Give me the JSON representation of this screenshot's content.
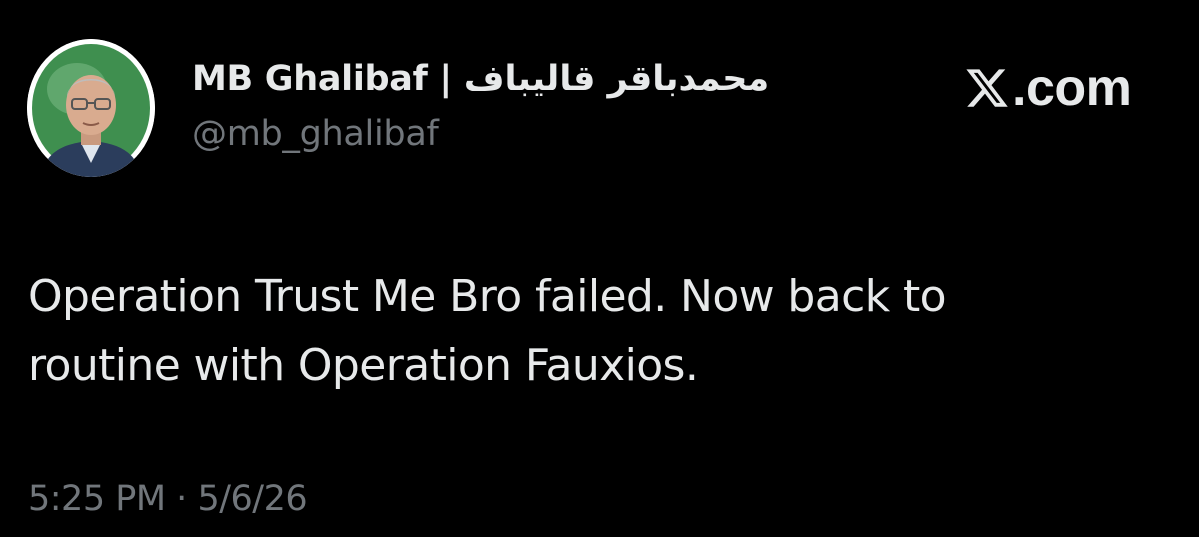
{
  "tweet": {
    "display_name": "MB Ghalibaf | محمدباقر قالیباف",
    "handle": "@mb_ghalibaf",
    "text": "Operation Trust Me Bro failed. Now back to\nroutine with Operation Fauxios.",
    "time": "5:25 PM",
    "separator": "·",
    "date": "5/6/26",
    "avatar_icon": "profile-photo"
  },
  "brand": {
    "logo_icon": "x-logo-icon",
    "domain": ".com"
  },
  "colors": {
    "background": "#000000",
    "primary_text": "#e7e9ea",
    "secondary_text": "#71767b",
    "avatar_ring": "#3f8f4f"
  }
}
